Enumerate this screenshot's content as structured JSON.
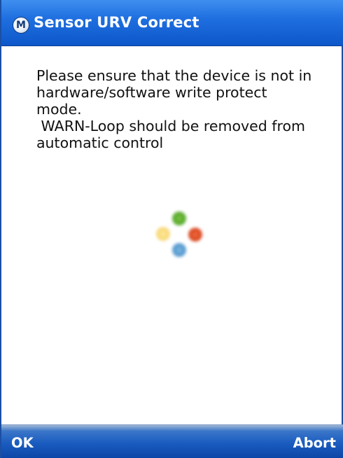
{
  "window": {
    "icon_letter": "M",
    "title": "Sensor URV Correct"
  },
  "message": {
    "text": "Please ensure that the device is not in\nhardware/software write protect\nmode.\n WARN-Loop should be removed from\nautomatic control"
  },
  "spinner": {
    "icon": "busy-spinner-icon",
    "dot_colors": [
      "#55a82a",
      "#d9471f",
      "#f5c945",
      "#3f8ac6"
    ]
  },
  "softkeys": {
    "left_label": "OK",
    "right_label": "Abort"
  },
  "colors": {
    "title_bar": "#1f6fe0",
    "softkey_bar": "#1a5cc0",
    "text": "#111111"
  }
}
